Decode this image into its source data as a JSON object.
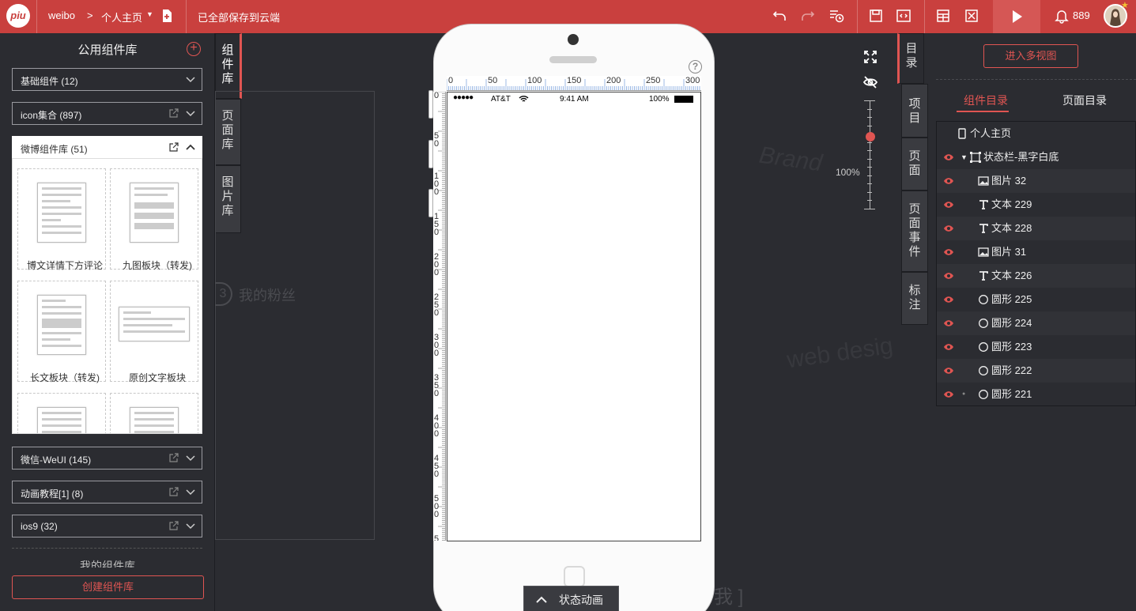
{
  "topbar": {
    "logo": "piu",
    "project": "weibo",
    "separator": ">",
    "page": "个人主页",
    "save_status": "已全部保存到云端",
    "notification_count": "889"
  },
  "left_panel": {
    "title": "公用组件库",
    "libraries": [
      {
        "label": "基础组件 (12)"
      },
      {
        "label": "icon集合 (897)"
      },
      {
        "label": "微博组件库 (51)"
      },
      {
        "label": "微信-WeUI (145)"
      },
      {
        "label": "动画教程[1] (8)"
      },
      {
        "label": "ios9 (32)"
      }
    ],
    "components": [
      {
        "label": "博文详情下方评论"
      },
      {
        "label": "九图板块（转发)"
      },
      {
        "label": "长文板块（转发)"
      },
      {
        "label": "原创文字板块"
      }
    ],
    "my_libs": "我的组件库",
    "create_button": "创建组件库"
  },
  "left_tabs": {
    "components": "组件库",
    "pages": "页面库",
    "images": "图片库"
  },
  "canvas": {
    "ghost_fans": "我的粉丝",
    "ghost_number": "3",
    "ghost_bracket": "我 ]",
    "ghost_right1": "Brand",
    "ghost_right2": "web desig"
  },
  "phone": {
    "status": {
      "carrier": "AT&T",
      "time": "9:41 AM",
      "battery": "100%"
    },
    "ruler_h": [
      "0",
      "50",
      "100",
      "150",
      "200",
      "250",
      "300"
    ],
    "ruler_v": [
      "0",
      "50",
      "100",
      "150",
      "200",
      "250",
      "300",
      "350",
      "400",
      "450",
      "500",
      "55"
    ],
    "help": "?",
    "bottom_tab": "状态动画"
  },
  "zoom": {
    "label": "100%",
    "level_fraction": 0.67
  },
  "right_tabs": {
    "toc": "目录",
    "project": "项目",
    "page": "页面",
    "page_events": "页面事件",
    "annotate": "标注"
  },
  "right_panel": {
    "multi_view_button": "进入多视图",
    "tabs": [
      {
        "label": "组件目录"
      },
      {
        "label": "页面目录"
      }
    ],
    "tree": [
      {
        "label": "个人主页",
        "icon": "phone"
      },
      {
        "label": "状态栏-黑字白底",
        "icon": "group"
      },
      {
        "label": "图片 32",
        "icon": "image"
      },
      {
        "label": "文本 229",
        "icon": "text"
      },
      {
        "label": "文本 228",
        "icon": "text"
      },
      {
        "label": "图片 31",
        "icon": "image"
      },
      {
        "label": "文本 226",
        "icon": "text"
      },
      {
        "label": "圆形 225",
        "icon": "circle"
      },
      {
        "label": "圆形 224",
        "icon": "circle"
      },
      {
        "label": "圆形 223",
        "icon": "circle"
      },
      {
        "label": "圆形 222",
        "icon": "circle"
      },
      {
        "label": "圆形 221",
        "icon": "circle"
      }
    ]
  },
  "colors": {
    "brand": "#c9403e",
    "accent": "#e05552",
    "panel": "#2b2c31"
  }
}
